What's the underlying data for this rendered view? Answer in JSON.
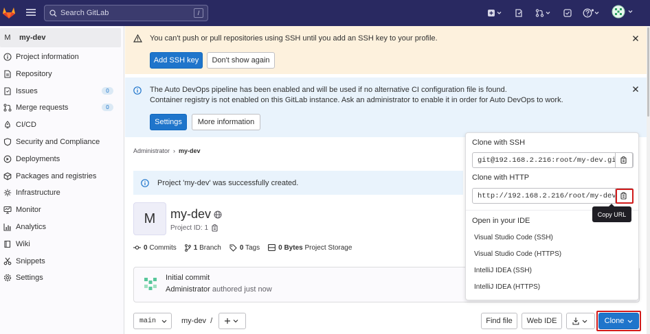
{
  "topbar": {
    "search_placeholder": "Search GitLab",
    "search_shortcut": "/",
    "icons": [
      "gitlab-logo-icon",
      "menu-icon",
      "search-icon",
      "plus-icon",
      "issues-icon",
      "merge-request-icon",
      "todo-icon",
      "help-icon",
      "avatar-icon"
    ]
  },
  "sidebar": {
    "project_avatar_letter": "M",
    "project_name": "my-dev",
    "items": [
      {
        "label": "Project information",
        "icon": "info-icon"
      },
      {
        "label": "Repository",
        "icon": "doc-icon"
      },
      {
        "label": "Issues",
        "icon": "issues-icon",
        "badge": "0"
      },
      {
        "label": "Merge requests",
        "icon": "merge-request-icon",
        "badge": "0"
      },
      {
        "label": "CI/CD",
        "icon": "rocket-icon"
      },
      {
        "label": "Security and Compliance",
        "icon": "shield-icon"
      },
      {
        "label": "Deployments",
        "icon": "deploy-icon"
      },
      {
        "label": "Packages and registries",
        "icon": "package-icon"
      },
      {
        "label": "Infrastructure",
        "icon": "cloud-icon"
      },
      {
        "label": "Monitor",
        "icon": "monitor-icon"
      },
      {
        "label": "Analytics",
        "icon": "chart-icon"
      },
      {
        "label": "Wiki",
        "icon": "book-icon"
      },
      {
        "label": "Snippets",
        "icon": "scissors-icon"
      },
      {
        "label": "Settings",
        "icon": "gear-icon"
      }
    ]
  },
  "ssh_alert": {
    "message": "You can't push or pull repositories using SSH until you add an SSH key to your profile.",
    "primary_button": "Add SSH key",
    "secondary_button": "Don't show again"
  },
  "devops_alert": {
    "line1": "The Auto DevOps pipeline has been enabled and will be used if no alternative CI configuration file is found.",
    "line2": "Container registry is not enabled on this GitLab instance. Ask an administrator to enable it in order for Auto DevOps to work.",
    "primary_button": "Settings",
    "secondary_button": "More information"
  },
  "breadcrumb": {
    "parent": "Administrator",
    "current": "my-dev"
  },
  "success_message": "Project 'my-dev' was successfully created.",
  "project": {
    "avatar_letter": "M",
    "title": "my-dev",
    "id_label": "Project ID: 1"
  },
  "stats": {
    "commits_count": "0",
    "commits_label": "Commits",
    "branch_count": "1",
    "branch_label": "Branch",
    "tags_count": "0",
    "tags_label": "Tags",
    "storage_value": "0 Bytes",
    "storage_label": "Project Storage"
  },
  "commit": {
    "title": "Initial commit",
    "author": "Administrator",
    "time": "authored just now"
  },
  "repo_toolbar": {
    "branch": "main",
    "path": "my-dev",
    "path_sep": "/",
    "find_file": "Find file",
    "web_ide": "Web IDE",
    "clone": "Clone"
  },
  "clone_dropdown": {
    "ssh_label": "Clone with SSH",
    "ssh_url": "git@192.168.2.216:root/my-dev.git",
    "http_label": "Clone with HTTP",
    "http_url": "http://192.168.2.216/root/my-dev.git",
    "ide_label": "Open in your IDE",
    "ide_options": [
      "Visual Studio Code (SSH)",
      "Visual Studio Code (HTTPS)",
      "IntelliJ IDEA (SSH)",
      "IntelliJ IDEA (HTTPS)"
    ]
  },
  "tooltip": "Copy URL",
  "colors": {
    "topbar": "#292961",
    "primary": "#1f75cb",
    "warning_bg": "#fdf1dd",
    "info_bg": "#e9f3fc",
    "highlight": "#d11a1a"
  }
}
